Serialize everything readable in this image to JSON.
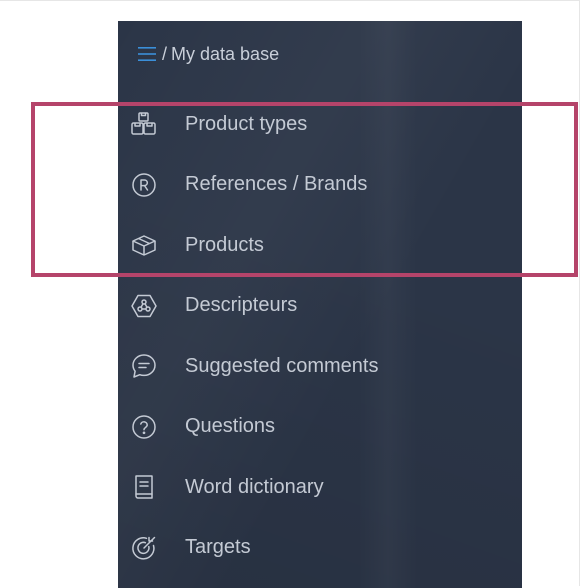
{
  "header": {
    "separator": "/",
    "title": "My data base"
  },
  "nav": {
    "items": [
      {
        "label": "Product types",
        "icon": "boxes-icon"
      },
      {
        "label": "References / Brands",
        "icon": "registered-icon"
      },
      {
        "label": "Products",
        "icon": "package-icon"
      },
      {
        "label": "Descripteurs",
        "icon": "molecule-icon"
      },
      {
        "label": "Suggested comments",
        "icon": "chat-bubble-icon"
      },
      {
        "label": "Questions",
        "icon": "question-icon"
      },
      {
        "label": "Word dictionary",
        "icon": "book-icon"
      },
      {
        "label": "Targets",
        "icon": "target-icon"
      }
    ]
  },
  "colors": {
    "panel_bg": "#2b3547",
    "text": "#c4cad4",
    "hamburger": "#3b8fd9",
    "highlight": "#b5446a"
  }
}
